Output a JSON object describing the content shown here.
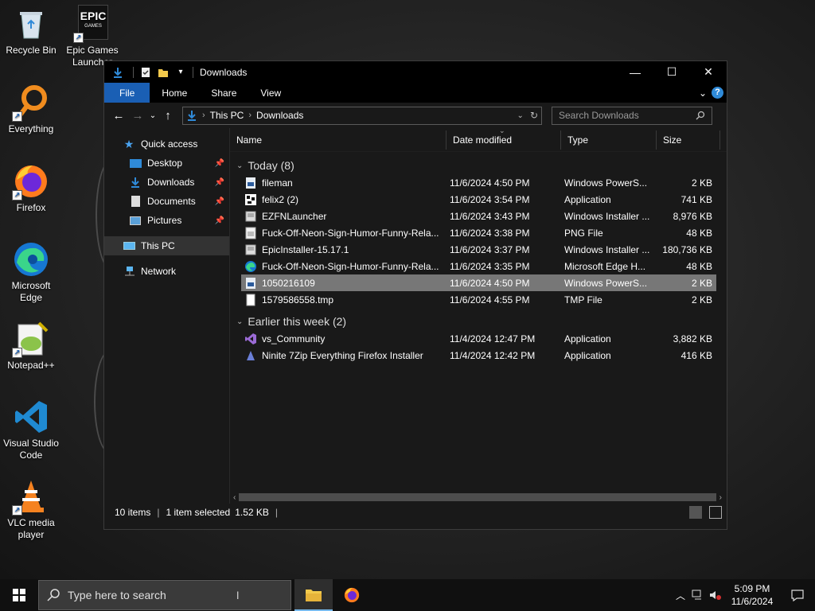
{
  "desktop": {
    "icons": [
      {
        "label": "Recycle Bin"
      },
      {
        "label": "Epic Games Launcher",
        "logo_top": "EPIC",
        "logo_bottom": "GAMES"
      },
      {
        "label": "Everything"
      },
      {
        "label": "Firefox"
      },
      {
        "label": "Microsoft Edge"
      },
      {
        "label": "Notepad++"
      },
      {
        "label": "Visual Studio Code"
      },
      {
        "label": "VLC media player"
      }
    ]
  },
  "explorer": {
    "title": "Downloads",
    "ribbon_tabs": [
      "File",
      "Home",
      "Share",
      "View"
    ],
    "address": {
      "root": "This PC",
      "current": "Downloads"
    },
    "search_placeholder": "Search Downloads",
    "nav": {
      "quick_access": "Quick access",
      "items": [
        "Desktop",
        "Downloads",
        "Documents",
        "Pictures"
      ],
      "this_pc": "This PC",
      "network": "Network"
    },
    "columns": {
      "name": "Name",
      "date": "Date modified",
      "type": "Type",
      "size": "Size"
    },
    "groups": [
      {
        "title": "Today (8)",
        "files": [
          {
            "name": "fileman",
            "date": "11/6/2024 4:50 PM",
            "type": "Windows PowerS...",
            "size": "2 KB",
            "icon": "powershell-file-icon"
          },
          {
            "name": "felix2 (2)",
            "date": "11/6/2024 3:54 PM",
            "type": "Application",
            "size": "741 KB",
            "icon": "application-icon"
          },
          {
            "name": "EZFNLauncher",
            "date": "11/6/2024 3:43 PM",
            "type": "Windows Installer ...",
            "size": "8,976 KB",
            "icon": "installer-icon"
          },
          {
            "name": "Fuck-Off-Neon-Sign-Humor-Funny-Rela...",
            "date": "11/6/2024 3:38 PM",
            "type": "PNG File",
            "size": "48 KB",
            "icon": "png-file-icon"
          },
          {
            "name": "EpicInstaller-15.17.1",
            "date": "11/6/2024 3:37 PM",
            "type": "Windows Installer ...",
            "size": "180,736 KB",
            "icon": "installer-icon"
          },
          {
            "name": "Fuck-Off-Neon-Sign-Humor-Funny-Rela...",
            "date": "11/6/2024 3:35 PM",
            "type": "Microsoft Edge H...",
            "size": "48 KB",
            "icon": "edge-html-icon"
          },
          {
            "name": "1050216109",
            "date": "11/6/2024 4:50 PM",
            "type": "Windows PowerS...",
            "size": "2 KB",
            "icon": "powershell-file-icon",
            "selected": true
          },
          {
            "name": "1579586558.tmp",
            "date": "11/6/2024 4:55 PM",
            "type": "TMP File",
            "size": "2 KB",
            "icon": "tmp-file-icon"
          }
        ]
      },
      {
        "title": "Earlier this week (2)",
        "files": [
          {
            "name": "vs_Community",
            "date": "11/4/2024 12:47 PM",
            "type": "Application",
            "size": "3,882 KB",
            "icon": "visual-studio-icon"
          },
          {
            "name": "Ninite 7Zip Everything Firefox Installer",
            "date": "11/4/2024 12:42 PM",
            "type": "Application",
            "size": "416 KB",
            "icon": "ninite-icon"
          }
        ]
      }
    ],
    "status": {
      "count": "10 items",
      "selected": "1 item selected",
      "size": "1.52 KB"
    }
  },
  "taskbar": {
    "search_placeholder": "Type here to search",
    "time": "5:09 PM",
    "date": "11/6/2024"
  },
  "colors": {
    "accent": "#1a5fb4",
    "selected_row": "#777777",
    "window_bg": "#191919"
  }
}
